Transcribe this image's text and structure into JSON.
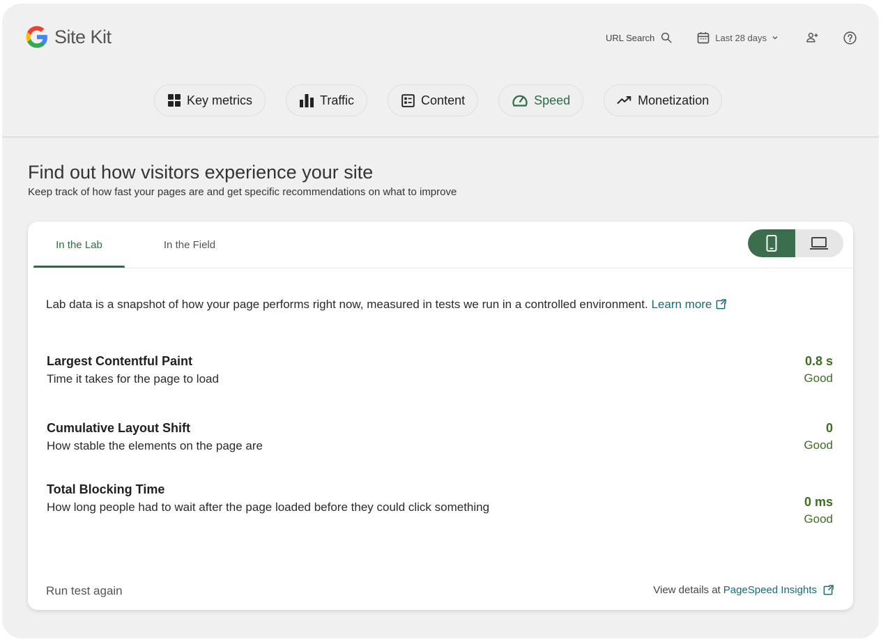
{
  "app": {
    "name": "Site Kit"
  },
  "header": {
    "url_search_label": "URL Search",
    "date_range_label": "Last 28 days"
  },
  "nav_chips": [
    {
      "label": "Key metrics",
      "icon": "dashboard-icon"
    },
    {
      "label": "Traffic",
      "icon": "bar-chart-icon"
    },
    {
      "label": "Content",
      "icon": "content-list-icon"
    },
    {
      "label": "Speed",
      "icon": "speedometer-icon",
      "active": true
    },
    {
      "label": "Monetization",
      "icon": "trending-up-icon"
    }
  ],
  "intro": {
    "title": "Find out how visitors experience your site",
    "subtitle": "Keep track of how fast your pages are and get specific recommendations on what to improve"
  },
  "card": {
    "tabs": [
      {
        "label": "In the Lab",
        "active": true
      },
      {
        "label": "In the Field",
        "active": false
      }
    ],
    "device_toggle": {
      "selected": "mobile",
      "options": [
        "mobile",
        "desktop"
      ]
    },
    "description": "Lab data is a snapshot of how your page performs right now, measured in tests we run in a controlled environment.",
    "learn_more_label": "Learn more",
    "metrics": [
      {
        "name": "Largest Contentful Paint",
        "description": "Time it takes for the page to load",
        "value": "0.8 s",
        "status": "Good"
      },
      {
        "name": "Cumulative Layout Shift",
        "description": "How stable the elements on the page are",
        "value": "0",
        "status": "Good"
      },
      {
        "name": "Total Blocking Time",
        "description": "How long people had to wait after the page loaded before they could click something",
        "value": "0 ms",
        "status": "Good"
      }
    ],
    "run_again_label": "Run test again",
    "view_details_prefix": "View details at",
    "view_details_link": "PageSpeed Insights"
  },
  "colors": {
    "accent": "#2f6b45",
    "good": "#3d6e21",
    "link": "#1a6a73",
    "background": "#f0f0f0"
  }
}
